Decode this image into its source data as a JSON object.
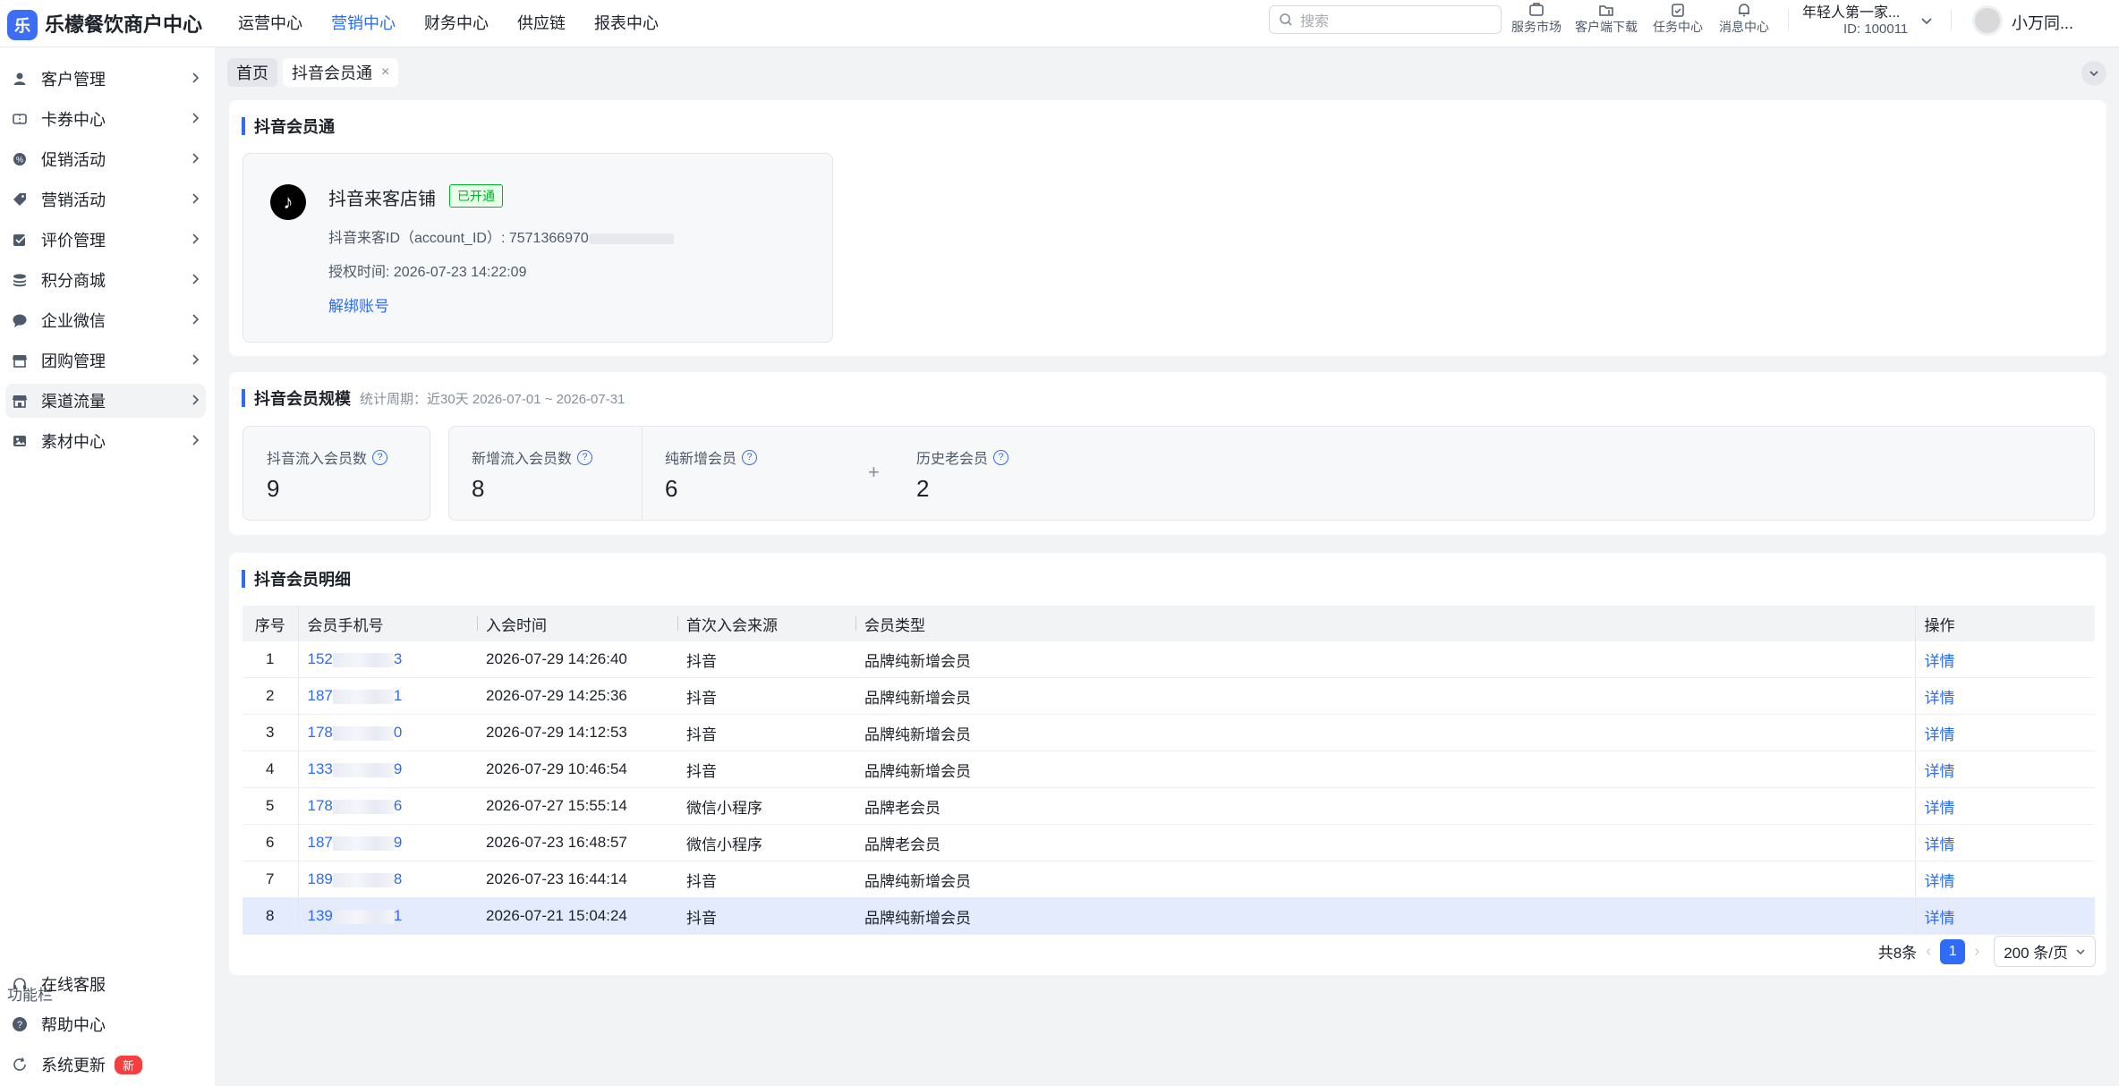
{
  "app": {
    "logo_char": "乐",
    "title": "乐檬餐饮商户中心"
  },
  "top_nav": [
    {
      "label": "运营中心",
      "active": false
    },
    {
      "label": "营销中心",
      "active": true
    },
    {
      "label": "财务中心",
      "active": false
    },
    {
      "label": "供应链",
      "active": false
    },
    {
      "label": "报表中心",
      "active": false
    }
  ],
  "search": {
    "placeholder": "搜索"
  },
  "toolbar": {
    "market": "服务市场",
    "download": "客户端下载",
    "tasks": "任务中心",
    "messages": "消息中心"
  },
  "account": {
    "shop_name": "年轻人第一家...",
    "shop_id": "ID: 100011",
    "user_name": "小万同..."
  },
  "sidebar": {
    "items": [
      {
        "label": "客户管理",
        "icon": "user-icon"
      },
      {
        "label": "卡券中心",
        "icon": "ticket-icon"
      },
      {
        "label": "促销活动",
        "icon": "discount-icon"
      },
      {
        "label": "营销活动",
        "icon": "tag-icon"
      },
      {
        "label": "评价管理",
        "icon": "review-icon"
      },
      {
        "label": "积分商城",
        "icon": "coins-icon"
      },
      {
        "label": "企业微信",
        "icon": "chat-icon"
      },
      {
        "label": "团购管理",
        "icon": "store-icon"
      },
      {
        "label": "渠道流量",
        "icon": "channel-icon",
        "active": true
      },
      {
        "label": "素材中心",
        "icon": "image-icon"
      }
    ],
    "function_title": "功能栏",
    "functions": [
      {
        "label": "在线客服",
        "icon": "headset-icon"
      },
      {
        "label": "帮助中心",
        "icon": "help-icon"
      },
      {
        "label": "系统更新",
        "icon": "refresh-icon",
        "badge": "新"
      }
    ]
  },
  "tabs": {
    "home": "首页",
    "current": "抖音会员通",
    "close": "×"
  },
  "binding_card": {
    "title": "抖音会员通",
    "account_name": "抖音来客店铺",
    "status": "已开通",
    "account_id_label": "抖音来客ID（account_ID）: ",
    "account_id_value": "7571366970",
    "auth_time_label": "授权时间: ",
    "auth_time_value": "2026-07-23 14:22:09",
    "unbind": "解绑账号"
  },
  "scale_card": {
    "title": "抖音会员规模",
    "period": "统计周期：近30天 2026-07-01 ~ 2026-07-31",
    "stats": [
      {
        "label": "抖音流入会员数",
        "value": "9"
      },
      {
        "label": "新增流入会员数",
        "value": "8"
      },
      {
        "label": "纯新增会员",
        "value": "6"
      },
      {
        "label": "历史老会员",
        "value": "2"
      }
    ],
    "plus": "+",
    "help": "?"
  },
  "detail_card": {
    "title": "抖音会员明细",
    "columns": {
      "idx": "序号",
      "phone": "会员手机号",
      "join_time": "入会时间",
      "source": "首次入会来源",
      "type": "会员类型",
      "op": "操作"
    },
    "rows": [
      {
        "idx": "1",
        "phone_prefix": "152",
        "phone_suffix": "3",
        "join_time": "2026-07-29 14:26:40",
        "source": "抖音",
        "type": "品牌纯新增会员",
        "op": "详情"
      },
      {
        "idx": "2",
        "phone_prefix": "187",
        "phone_suffix": "1",
        "join_time": "2026-07-29 14:25:36",
        "source": "抖音",
        "type": "品牌纯新增会员",
        "op": "详情"
      },
      {
        "idx": "3",
        "phone_prefix": "178",
        "phone_suffix": "0",
        "join_time": "2026-07-29 14:12:53",
        "source": "抖音",
        "type": "品牌纯新增会员",
        "op": "详情"
      },
      {
        "idx": "4",
        "phone_prefix": "133",
        "phone_suffix": "9",
        "join_time": "2026-07-29 10:46:54",
        "source": "抖音",
        "type": "品牌纯新增会员",
        "op": "详情"
      },
      {
        "idx": "5",
        "phone_prefix": "178",
        "phone_suffix": "6",
        "join_time": "2026-07-27 15:55:14",
        "source": "微信小程序",
        "type": "品牌老会员",
        "op": "详情"
      },
      {
        "idx": "6",
        "phone_prefix": "187",
        "phone_suffix": "9",
        "join_time": "2026-07-23 16:48:57",
        "source": "微信小程序",
        "type": "品牌老会员",
        "op": "详情"
      },
      {
        "idx": "7",
        "phone_prefix": "189",
        "phone_suffix": "8",
        "join_time": "2026-07-23 16:44:14",
        "source": "抖音",
        "type": "品牌纯新增会员",
        "op": "详情"
      },
      {
        "idx": "8",
        "phone_prefix": "139",
        "phone_suffix": "1",
        "join_time": "2026-07-21 15:04:24",
        "source": "抖音",
        "type": "品牌纯新增会员",
        "op": "详情",
        "selected": true
      }
    ]
  },
  "pagination": {
    "total": "共8条",
    "page": "1",
    "page_size": "200 条/页"
  },
  "colors": {
    "primary": "#2f6bf6",
    "success": "#00b42a",
    "danger": "#f53f3f",
    "selected_row": "#e3ebfd"
  }
}
